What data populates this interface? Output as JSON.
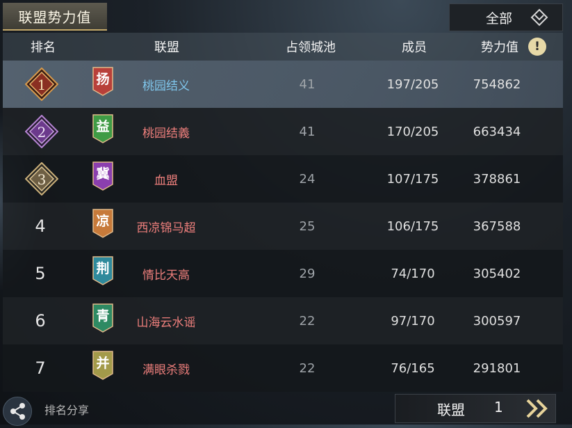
{
  "title": "联盟势力值",
  "filter": {
    "label": "全部"
  },
  "columns": {
    "rank": "排名",
    "alliance": "联盟",
    "cities": "占领城池",
    "members": "成员",
    "power": "势力值"
  },
  "info_icon": "!",
  "rows": [
    {
      "rank": "1",
      "flag": "扬",
      "flag_color": "#b8403a",
      "name": "桃园结义",
      "cities": "41",
      "members": "197/205",
      "power": "754862"
    },
    {
      "rank": "2",
      "flag": "益",
      "flag_color": "#3f9b45",
      "name": "桃园结義",
      "cities": "41",
      "members": "170/205",
      "power": "663434"
    },
    {
      "rank": "3",
      "flag": "冀",
      "flag_color": "#8b3fae",
      "name": "血盟",
      "cities": "24",
      "members": "107/175",
      "power": "378861"
    },
    {
      "rank": "4",
      "flag": "凉",
      "flag_color": "#c77a3a",
      "name": "西凉锦马超",
      "cities": "25",
      "members": "106/175",
      "power": "367588"
    },
    {
      "rank": "5",
      "flag": "荆",
      "flag_color": "#2f8a9c",
      "name": "情比天高",
      "cities": "29",
      "members": "74/170",
      "power": "305402"
    },
    {
      "rank": "6",
      "flag": "青",
      "flag_color": "#2e8a63",
      "name": "山海云水谣",
      "cities": "22",
      "members": "97/170",
      "power": "300597"
    },
    {
      "rank": "7",
      "flag": "并",
      "flag_color": "#a39a4a",
      "name": "满眼杀戮",
      "cities": "22",
      "members": "76/165",
      "power": "291801"
    }
  ],
  "footer": {
    "share_label": "排名分享",
    "my_alliance_label": "联盟",
    "my_alliance_rank": "1"
  },
  "badge_colors": {
    "gold": "#c9843a",
    "purple": "#8a4fb0",
    "bronze": "#b89a62"
  }
}
